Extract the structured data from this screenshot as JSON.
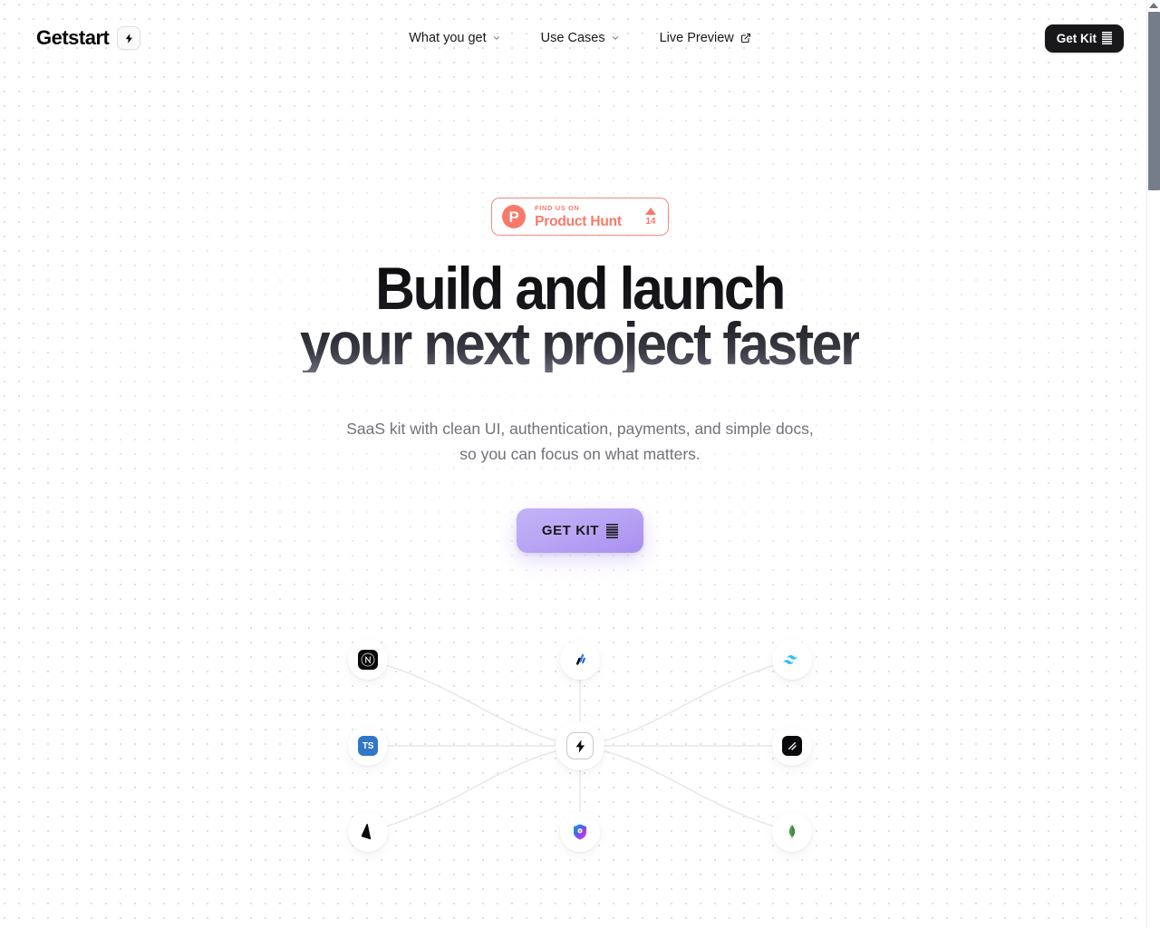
{
  "brand": {
    "name": "Getstart",
    "logo_icon": "lightning-bolt-icon"
  },
  "nav": {
    "items": [
      {
        "label": "What you get",
        "icon": "chevron-down-icon",
        "type": "dropdown"
      },
      {
        "label": "Use Cases",
        "icon": "chevron-down-icon",
        "type": "dropdown"
      },
      {
        "label": "Live Preview",
        "icon": "external-link-icon",
        "type": "link"
      }
    ],
    "cta": {
      "label": "Get Kit",
      "icon": "kit-stripes-icon"
    }
  },
  "hero": {
    "badge": {
      "kicker": "FIND US ON",
      "name": "Product Hunt",
      "mark": "P",
      "votes": "14",
      "vote_icon": "upvote-triangle-icon",
      "color": "#f8796a"
    },
    "headline_line1": "Build and launch",
    "headline_line2": "your next project faster",
    "subtitle": "SaaS kit with clean UI, authentication, payments, and simple docs, so you can focus on what matters.",
    "cta": {
      "label": "GET KIT",
      "icon": "kit-stripes-icon",
      "color": "#b9a6f4"
    }
  },
  "tech": {
    "center": {
      "name": "getstart-bolt",
      "icon": "lightning-bolt-icon"
    },
    "nodes": [
      {
        "name": "nextjs",
        "icon": "nextjs-icon",
        "position": "top-left"
      },
      {
        "name": "drizzle",
        "icon": "drizzle-icon",
        "position": "top-center"
      },
      {
        "name": "tailwindcss",
        "icon": "tailwind-icon",
        "position": "top-right"
      },
      {
        "name": "typescript",
        "icon": "typescript-icon",
        "position": "mid-left"
      },
      {
        "name": "shadcn-ui",
        "icon": "shadcn-icon",
        "position": "mid-right"
      },
      {
        "name": "prisma",
        "icon": "prisma-icon",
        "position": "bottom-left"
      },
      {
        "name": "clerk",
        "icon": "clerk-icon",
        "position": "bottom-center"
      },
      {
        "name": "mongodb",
        "icon": "mongodb-icon",
        "position": "bottom-right"
      }
    ]
  },
  "scrollbar": {
    "position": "right",
    "thumb_top": "13",
    "thumb_height": "197"
  }
}
